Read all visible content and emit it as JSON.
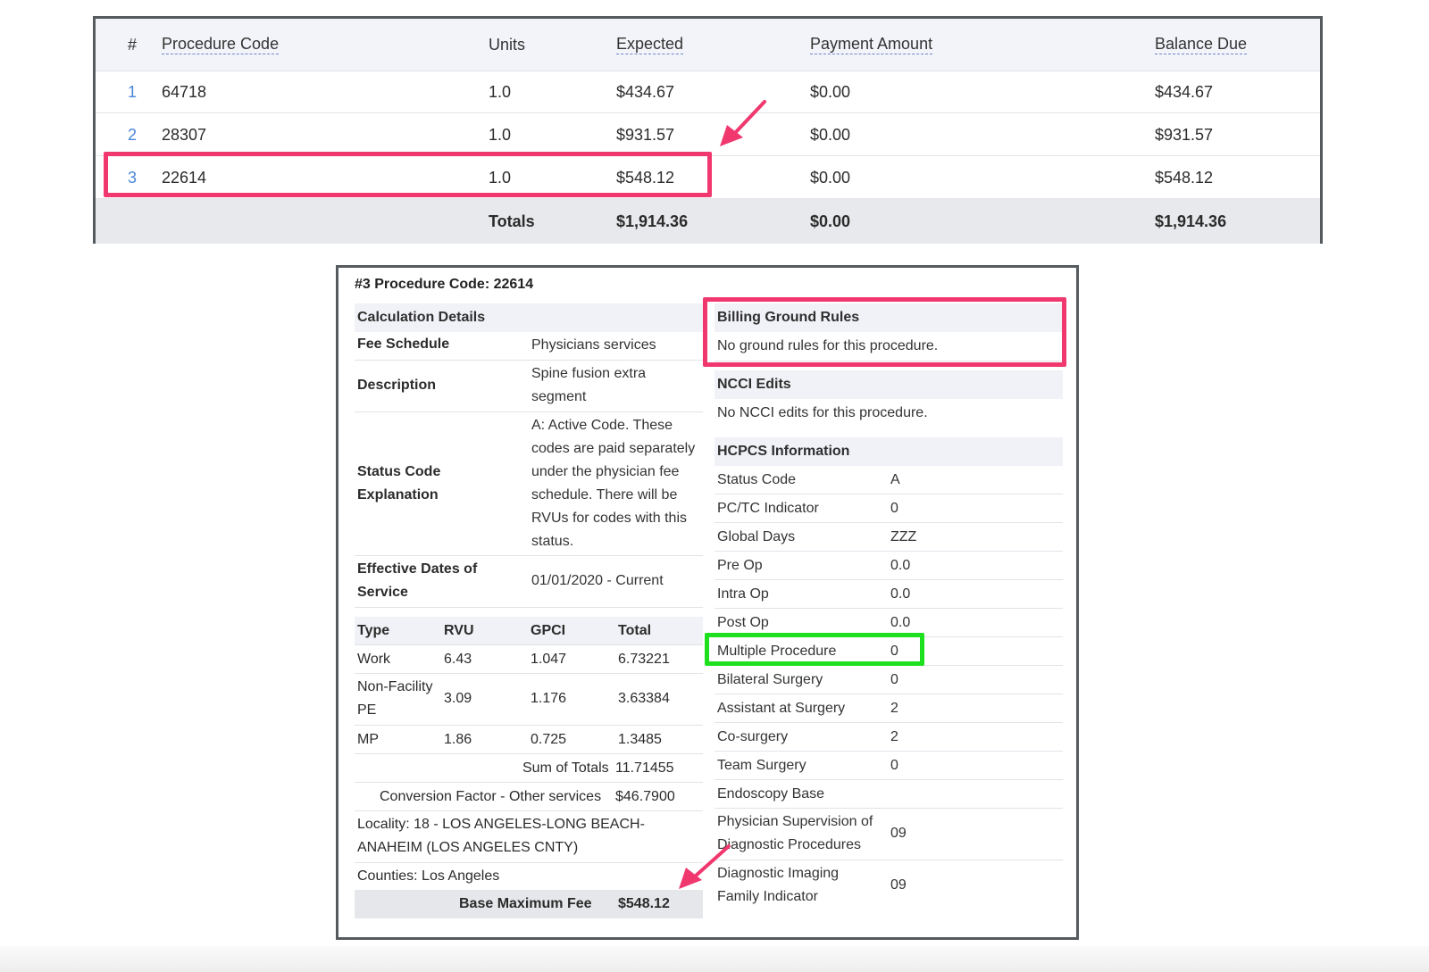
{
  "top_table": {
    "headers": {
      "num": "#",
      "code": "Procedure Code",
      "units": "Units",
      "expected": "Expected",
      "payment": "Payment Amount",
      "balance": "Balance Due"
    },
    "rows": [
      {
        "num": "1",
        "code": "64718",
        "units": "1.0",
        "expected": "$434.67",
        "payment": "$0.00",
        "balance": "$434.67"
      },
      {
        "num": "2",
        "code": "28307",
        "units": "1.0",
        "expected": "$931.57",
        "payment": "$0.00",
        "balance": "$931.57"
      },
      {
        "num": "3",
        "code": "22614",
        "units": "1.0",
        "expected": "$548.12",
        "payment": "$0.00",
        "balance": "$548.12"
      }
    ],
    "totals": {
      "label": "Totals",
      "expected": "$1,914.36",
      "payment": "$0.00",
      "balance": "$1,914.36"
    }
  },
  "detail": {
    "title": "#3 Procedure Code: 22614",
    "calc_header": "Calculation Details",
    "fee_schedule": {
      "label": "Fee Schedule",
      "value": "Physicians services"
    },
    "description": {
      "label": "Description",
      "value": "Spine fusion extra segment"
    },
    "status_code_explanation": {
      "label": "Status Code Explanation",
      "value": "A: Active Code. These codes are paid separately under the physician fee schedule. There will be RVUs for codes with this status."
    },
    "effective_dates": {
      "label": "Effective Dates of Service",
      "value": "01/01/2020 - Current"
    },
    "rvu_table": {
      "headers": {
        "type": "Type",
        "rvu": "RVU",
        "gpci": "GPCI",
        "total": "Total"
      },
      "rows": [
        {
          "type": "Work",
          "rvu": "6.43",
          "gpci": "1.047",
          "total": "6.73221"
        },
        {
          "type": "Non-Facility PE",
          "rvu": "3.09",
          "gpci": "1.176",
          "total": "3.63384"
        },
        {
          "type": "MP",
          "rvu": "1.86",
          "gpci": "0.725",
          "total": "1.3485"
        }
      ],
      "sum_label": "Sum of Totals",
      "sum_value": "11.71455"
    },
    "conversion_factor": {
      "label": "Conversion Factor - Other services",
      "value": "$46.7900"
    },
    "locality": "Locality: 18 - LOS ANGELES-LONG BEACH-ANAHEIM (LOS ANGELES CNTY)",
    "counties": "Counties: Los Angeles",
    "base_max_fee": {
      "label": "Base Maximum Fee",
      "value": "$548.12"
    },
    "billing_rules": {
      "header": "Billing Ground Rules",
      "text": "No ground rules for this procedure."
    },
    "ncci": {
      "header": "NCCI Edits",
      "text": "No NCCI edits for this procedure."
    },
    "hcpcs": {
      "header": "HCPCS Information",
      "rows": [
        {
          "key": "Status Code",
          "value": "A"
        },
        {
          "key": "PC/TC Indicator",
          "value": "0"
        },
        {
          "key": "Global Days",
          "value": "ZZZ"
        },
        {
          "key": "Pre Op",
          "value": "0.0"
        },
        {
          "key": "Intra Op",
          "value": "0.0"
        },
        {
          "key": "Post Op",
          "value": "0.0"
        },
        {
          "key": "Multiple Procedure",
          "value": "0"
        },
        {
          "key": "Bilateral Surgery",
          "value": "0"
        },
        {
          "key": "Assistant at Surgery",
          "value": "2"
        },
        {
          "key": "Co-surgery",
          "value": "2"
        },
        {
          "key": "Team Surgery",
          "value": "0"
        },
        {
          "key": "Endoscopy Base",
          "value": ""
        }
      ],
      "physician_supervision": {
        "key": "Physician Supervision of Diagnostic Procedures",
        "value": "09"
      },
      "imaging_family": {
        "key": "Diagnostic Imaging Family Indicator",
        "value": "09"
      }
    }
  },
  "colors": {
    "highlight_pink": "#f0386f",
    "highlight_green": "#1ee01e",
    "link_blue": "#4a86d8"
  }
}
